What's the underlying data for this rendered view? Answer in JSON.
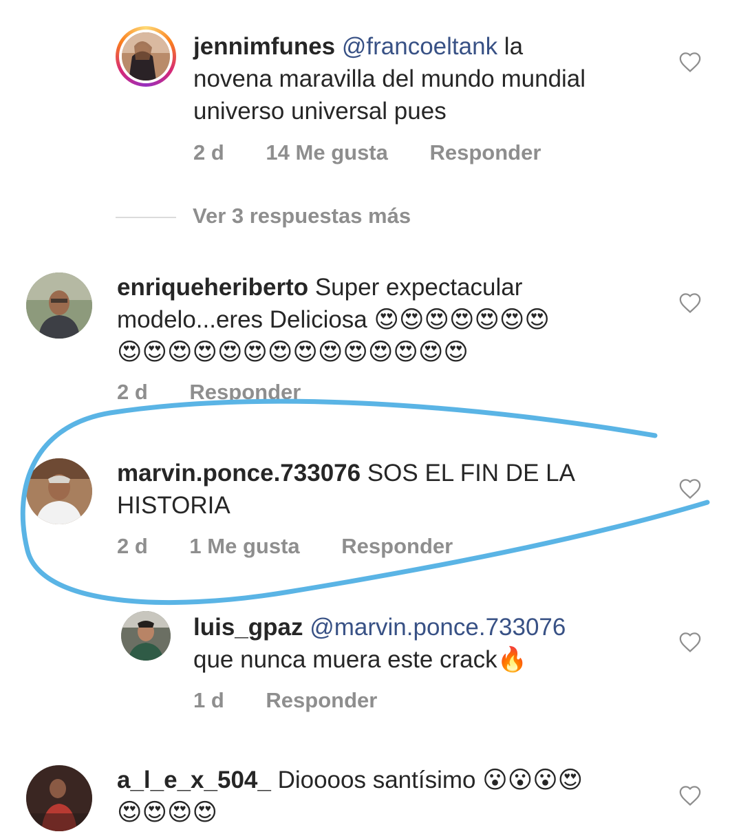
{
  "comments": [
    {
      "username": "jennimfunes",
      "mention": "@francoeltank",
      "text_line1": " la",
      "text_line2": "novena maravilla del mundo mundial",
      "text_line3": "universo universal pues",
      "time": "2 d",
      "likes": "14 Me gusta",
      "reply": "Responder"
    },
    {
      "username": "enriqueheriberto",
      "text_line1": " Super expectacular",
      "text_line2": "modelo...eres Deliciosa ",
      "emoji_line2": "😍😍😍😍😍😍😍",
      "emoji_line3": "😍😍😍😍😍😍😍😍😍😍😍😍😍😍",
      "time": "2 d",
      "reply": "Responder"
    },
    {
      "username": "marvin.ponce.733076",
      "text_line1": " SOS EL FIN DE LA",
      "text_line2": "HISTORIA",
      "time": "2 d",
      "likes": "1 Me gusta",
      "reply": "Responder"
    },
    {
      "username": "luis_gpaz",
      "mention": "@marvin.ponce.733076",
      "text_line2": "que nunca muera este crack",
      "emoji_line2": "🔥",
      "time": "1 d",
      "reply": "Responder"
    },
    {
      "username": "a_l_e_x_504_",
      "text_line1": " Dioooos santísimo ",
      "emoji_line1": "😮😮😮😍",
      "emoji_line2": "😍😍😍😍"
    }
  ],
  "view_more": "Ver 3 respuestas más",
  "icons": {
    "heart": "heart-outline-icon",
    "annotation": "blue-freehand-circle"
  },
  "colors": {
    "text": "#262626",
    "meta": "#8e8e8e",
    "mention": "#385185",
    "annotation": "#5ab4e5"
  }
}
